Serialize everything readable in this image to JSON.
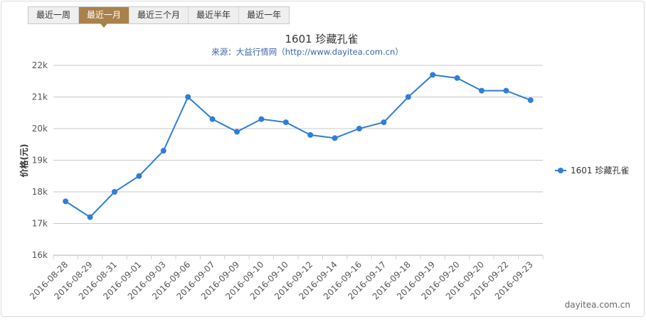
{
  "tabs": [
    {
      "label": "最近一周",
      "active": false
    },
    {
      "label": "最近一月",
      "active": true
    },
    {
      "label": "最近三个月",
      "active": false
    },
    {
      "label": "最近半年",
      "active": false
    },
    {
      "label": "最近一年",
      "active": false
    }
  ],
  "credit": "dayitea.com.cn",
  "colors": {
    "series": "#2f7ed8",
    "tab_active": "#a9824b",
    "grid": "#c8c8c8"
  },
  "chart_data": {
    "type": "line",
    "title": "1601 珍藏孔雀",
    "subtitle": "来源：大益行情网（http://www.dayitea.com.cn）",
    "ylabel": "价格(元)",
    "xlabel": "",
    "ylim": [
      16000,
      22000
    ],
    "yticks": [
      16000,
      17000,
      18000,
      19000,
      20000,
      21000,
      22000
    ],
    "ytick_labels": [
      "16k",
      "17k",
      "18k",
      "19k",
      "20k",
      "21k",
      "22k"
    ],
    "grid": true,
    "legend_position": "right",
    "categories": [
      "2016-08-28",
      "2016-08-29",
      "2016-08-31",
      "2016-09-01",
      "2016-09-03",
      "2016-09-06",
      "2016-09-07",
      "2016-09-09",
      "2016-09-10",
      "2016-09-10",
      "2016-09-12",
      "2016-09-14",
      "2016-09-16",
      "2016-09-17",
      "2016-09-18",
      "2016-09-19",
      "2016-09-20",
      "2016-09-20",
      "2016-09-22",
      "2016-09-23"
    ],
    "series": [
      {
        "name": "1601 珍藏孔雀",
        "values": [
          17700,
          17200,
          18000,
          18500,
          19300,
          21000,
          20300,
          19900,
          20300,
          20200,
          19800,
          19700,
          20000,
          20200,
          21000,
          21700,
          21600,
          21200,
          21200,
          20900
        ]
      }
    ]
  }
}
